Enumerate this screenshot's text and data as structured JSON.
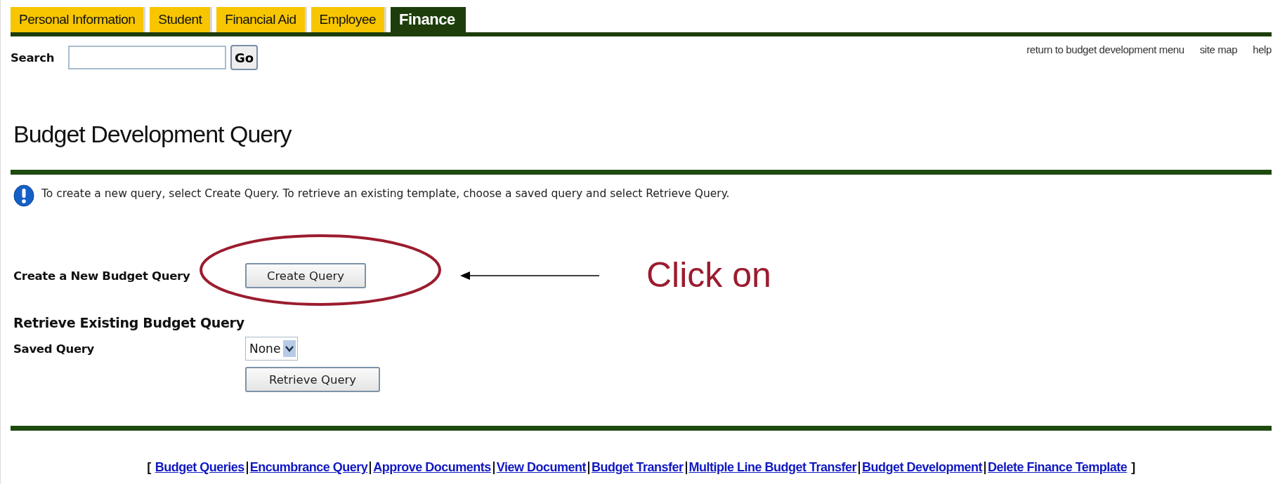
{
  "tabs": [
    {
      "label": "Personal Information",
      "selected": false
    },
    {
      "label": "Student",
      "selected": false
    },
    {
      "label": "Financial Aid",
      "selected": false
    },
    {
      "label": "Employee",
      "selected": false
    },
    {
      "label": "Finance",
      "selected": true
    }
  ],
  "search": {
    "label": "Search",
    "button": "Go"
  },
  "top_links": [
    "return to budget development menu",
    "site map",
    "help"
  ],
  "title": "Budget Development Query",
  "info": "To create a new query, select Create Query. To retrieve an existing template, choose a saved query and select Retrieve Query.",
  "create": {
    "label": "Create a New Budget Query",
    "button": "Create Query"
  },
  "retrieve": {
    "heading": "Retrieve Existing Budget Query",
    "label": "Saved Query",
    "select_value": "None",
    "button": "Retrieve Query"
  },
  "annotation": {
    "text": "Click on"
  },
  "footer": {
    "open_bracket": "[",
    "links": [
      "Budget Queries",
      "Encumbrance Query",
      "Approve Documents",
      "View Document",
      "Budget Transfer",
      "Multiple Line Budget Transfer",
      "Budget Development",
      "Delete Finance Template"
    ],
    "close_bracket": "]"
  }
}
